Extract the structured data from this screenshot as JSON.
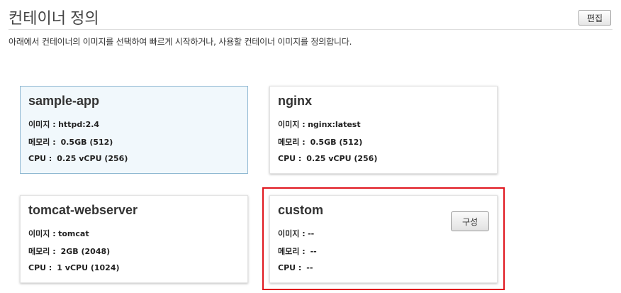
{
  "header": {
    "title": "컨테이너 정의",
    "edit_label": "편집",
    "description": "아래에서 컨테이너의 이미지를 선택하여 빠르게 시작하거나, 사용할 컨테이너 이미지를 정의합니다."
  },
  "cards": [
    {
      "name": "sample-app",
      "image_label": "이미지 :",
      "image": "httpd:2.4",
      "memory_label": "메모리 :",
      "memory": "0.5GB (512)",
      "cpu_label": "CPU :",
      "cpu": "0.25 vCPU (256)",
      "selected": true
    },
    {
      "name": "nginx",
      "image_label": "이미지 :",
      "image": "nginx:latest",
      "memory_label": "메모리 :",
      "memory": "0.5GB (512)",
      "cpu_label": "CPU :",
      "cpu": "0.25 vCPU (256)",
      "selected": false
    },
    {
      "name": "tomcat-webserver",
      "image_label": "이미지 :",
      "image": "tomcat",
      "memory_label": "메모리 :",
      "memory": "2GB (2048)",
      "cpu_label": "CPU :",
      "cpu": "1 vCPU (1024)",
      "selected": false
    },
    {
      "name": "custom",
      "image_label": "이미지 :",
      "image": "--",
      "memory_label": "메모리 :",
      "memory": "--",
      "cpu_label": "CPU :",
      "cpu": "--",
      "selected": false,
      "configure_label": "구성"
    }
  ],
  "colors": {
    "selected_bg": "#f1f8fc",
    "selected_border": "#8fb8d2",
    "highlight": "#e0161e"
  }
}
